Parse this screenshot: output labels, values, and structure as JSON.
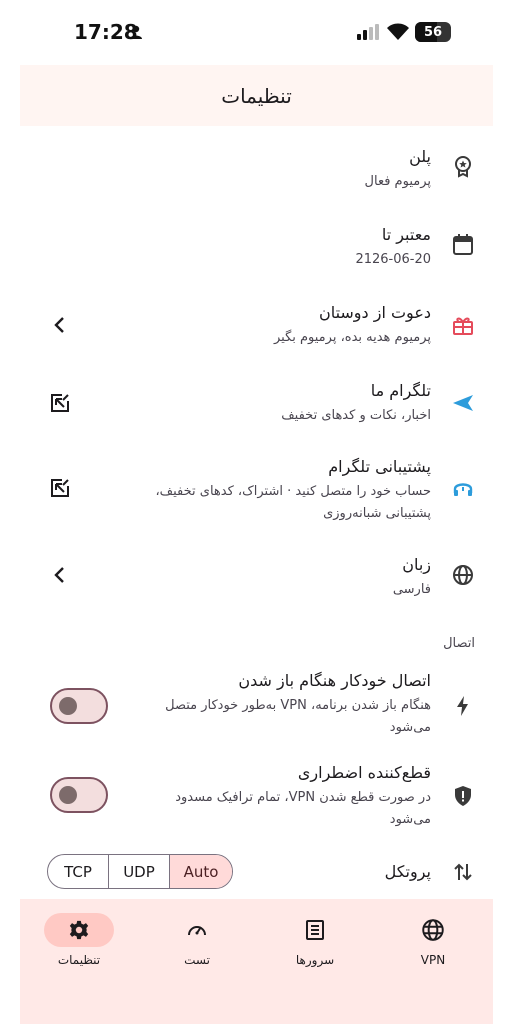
{
  "status": {
    "time": "17:28",
    "battery": "56"
  },
  "app": {
    "title": "تنظیمات"
  },
  "settings": [
    {
      "title": "پلن",
      "subtitle": "پرمیوم فعال"
    },
    {
      "title": "معتبر تا",
      "subtitle": "2126-06-20"
    },
    {
      "title": "دعوت از دوستان",
      "subtitle": "پرمیوم هدیه بده، پرمیوم بگیر"
    },
    {
      "title": "تلگرام ما",
      "subtitle": "اخبار، نکات و کدهای تخفیف"
    },
    {
      "title": "پشتیبانی تلگرام",
      "subtitle_line1": "حساب خود را متصل کنید · اشتراک، کدهای تخفیف،",
      "subtitle_line2": "پشتیبانی شبانه‌روزی"
    },
    {
      "title": "زبان",
      "subtitle": "فارسی"
    }
  ],
  "connection": {
    "section_label": "اتصال",
    "auto_connect": {
      "title": "اتصال خودکار هنگام باز شدن",
      "subtitle_line1": "هنگام باز شدن برنامه، VPN به‌طور خودکار متصل",
      "subtitle_line2": "می‌شود",
      "enabled": false
    },
    "kill_switch": {
      "title": "قطع‌کننده اضطراری",
      "subtitle_line1": "در صورت قطع شدن VPN، تمام ترافیک مسدود",
      "subtitle_line2": "می‌شود",
      "enabled": false
    },
    "protocol": {
      "label": "پروتکل",
      "options": [
        "TCP",
        "UDP",
        "Auto"
      ],
      "selected": "Auto"
    }
  },
  "nav": [
    {
      "label": "VPN",
      "icon": "globe-icon"
    },
    {
      "label": "سرورها",
      "icon": "list-icon"
    },
    {
      "label": "تست",
      "icon": "speedometer-icon"
    },
    {
      "label": "تنظیمات",
      "icon": "gear-icon",
      "active": true
    }
  ],
  "colors": {
    "accent": "#ffdad9",
    "nav_bg": "#ffe9e7",
    "header_bg": "#fff5f2",
    "telegram_blue": "#2d9cdb",
    "gift_red": "#e54b5b"
  }
}
